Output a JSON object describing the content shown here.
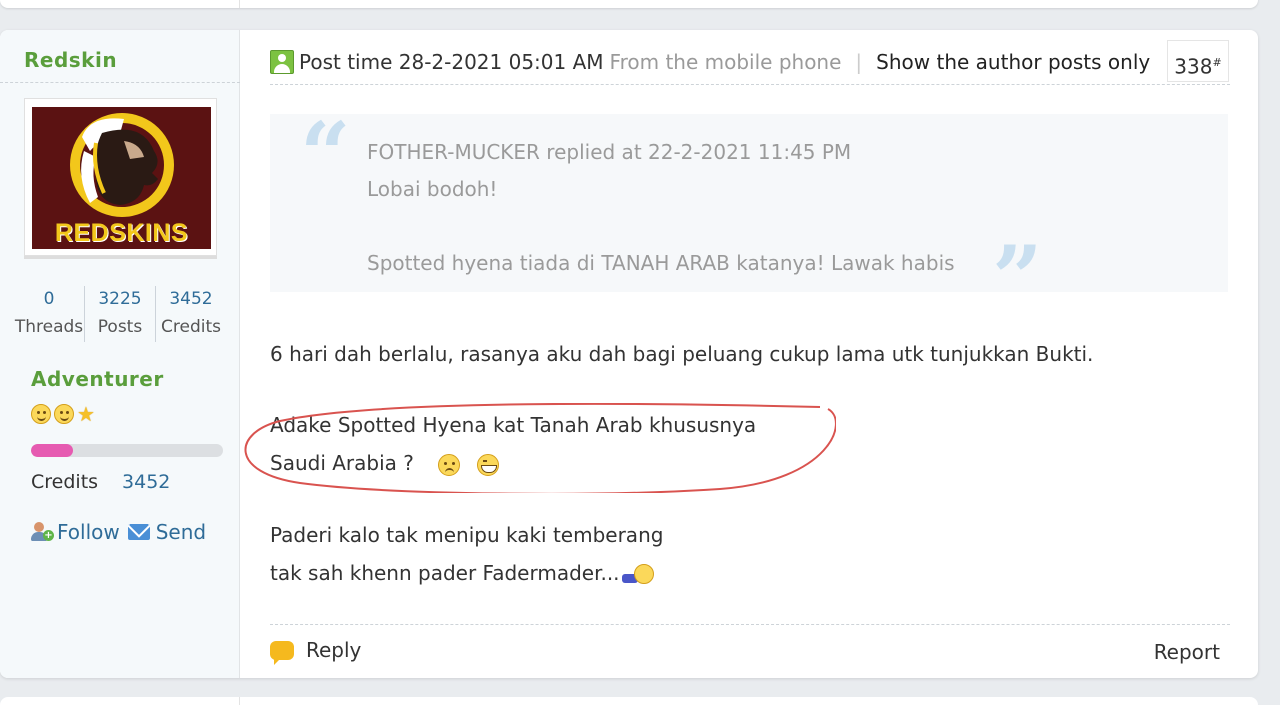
{
  "user": {
    "name": "Redskin",
    "avatar_text": "REDSKINS",
    "stats": [
      {
        "value": "0",
        "label": "Threads"
      },
      {
        "value": "3225",
        "label": "Posts"
      },
      {
        "value": "3452",
        "label": "Credits"
      }
    ],
    "rank": "Adventurer",
    "level_progress": 0.22,
    "credits_label": "Credits",
    "credits_value": "3452",
    "follow_label": "Follow",
    "send_label": "Send"
  },
  "post": {
    "time": "Post time 28-2-2021 05:01 AM",
    "source": "From the mobile phone",
    "separator": "|",
    "author_only": "Show the author posts only",
    "floor": "338",
    "floor_mark": "#"
  },
  "quote": {
    "attribution": "FOTHER-MUCKER replied at 22-2-2021 11:45 PM",
    "line1": "Lobai bodoh!",
    "line2": "Spotted hyena tiada di TANAH ARAB katanya! Lawak habis"
  },
  "body": {
    "p1": "6 hari dah berlalu, rasanya aku dah bagi peluang cukup lama utk tunjukkan Bukti.",
    "p2a": "Adake Spotted Hyena kat Tanah Arab khususnya",
    "p2b": "Saudi Arabia ?",
    "p3a": "Paderi kalo tak menipu kaki temberang",
    "p3b": "tak sah khenn pader Fadermader..."
  },
  "footer": {
    "reply_label": "Reply",
    "report_label": "Report"
  },
  "colors": {
    "accent_green": "#5a9e3c",
    "link_blue": "#2f6c98",
    "progress_pink": "#e65bb1",
    "annotation_red": "#d9534f"
  }
}
